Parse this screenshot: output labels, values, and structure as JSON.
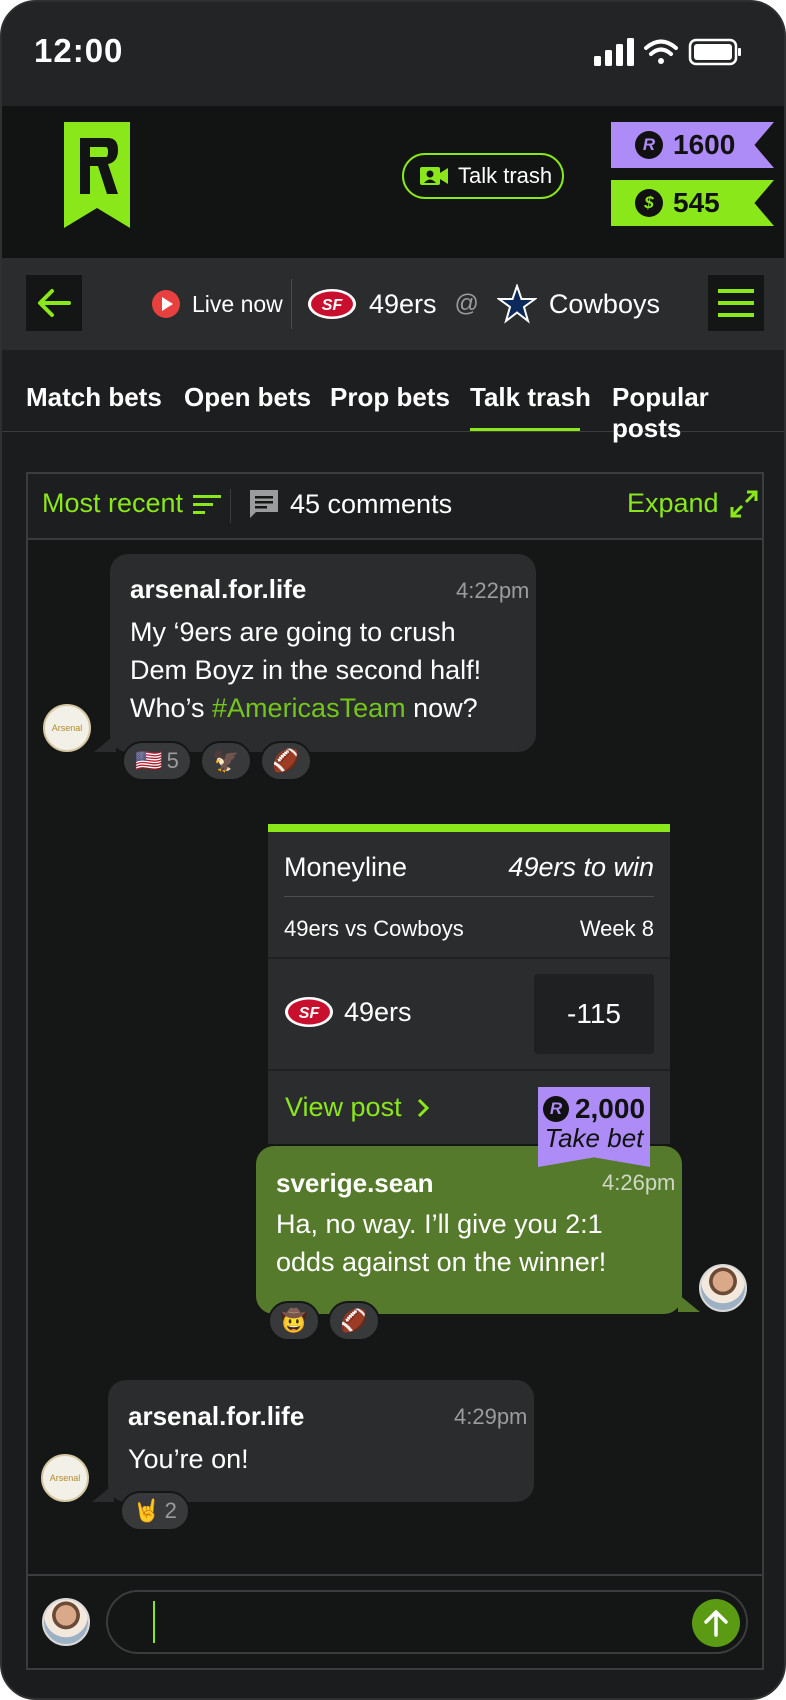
{
  "status_bar": {
    "time": "12:00"
  },
  "header": {
    "talk_trash_label": "Talk trash",
    "coins": "1600",
    "coins_symbol": "R",
    "cash": "545",
    "cash_symbol": "$"
  },
  "game": {
    "live_label": "Live now",
    "home_team": "49ers",
    "home_logo_text": "SF",
    "at": "@",
    "away_team": "Cowboys"
  },
  "tabs": [
    {
      "label": "Match bets"
    },
    {
      "label": "Open bets"
    },
    {
      "label": "Prop bets"
    },
    {
      "label": "Talk trash",
      "active": true
    },
    {
      "label": "Popular posts"
    }
  ],
  "feed": {
    "sort_label": "Most recent",
    "comment_count": "45 comments",
    "expand_label": "Expand"
  },
  "messages": [
    {
      "user": "arsenal.for.life",
      "time": "4:22pm",
      "lines": [
        "My ‘9ers are going to crush",
        "Dem Boyz in the second half!"
      ],
      "last_line_prefix": "Who’s ",
      "hashtag": "#AmericasTeam",
      "last_line_suffix": " now?",
      "avatar_text": "Arsenal",
      "reactions": [
        {
          "emoji": "🇺🇸",
          "count": "5"
        },
        {
          "emoji": "🦅"
        },
        {
          "emoji": "🏈"
        }
      ]
    },
    {
      "user": "sverige.sean",
      "time": "4:26pm",
      "lines": [
        "Ha, no way. I’ll give you 2:1",
        "odds against on the winner!"
      ],
      "reactions": [
        {
          "emoji": "🤠"
        },
        {
          "emoji": "🏈"
        }
      ]
    },
    {
      "user": "arsenal.for.life",
      "time": "4:29pm",
      "text": "You’re on!",
      "avatar_text": "Arsenal",
      "reactions": [
        {
          "emoji": "🤘",
          "count": "2"
        }
      ]
    }
  ],
  "bet_card": {
    "market": "Moneyline",
    "selection": "49ers to win",
    "matchup": "49ers vs Cowboys",
    "week": "Week 8",
    "team": "49ers",
    "team_logo_text": "SF",
    "odds": "-115",
    "view_post_label": "View post",
    "stake": "2,000",
    "stake_symbol": "R",
    "take_bet_label": "Take bet"
  },
  "colors": {
    "accent": "#8ae81a",
    "coins": "#ad8cf7",
    "live": "#e8403f",
    "own_bubble": "#557a2b"
  }
}
